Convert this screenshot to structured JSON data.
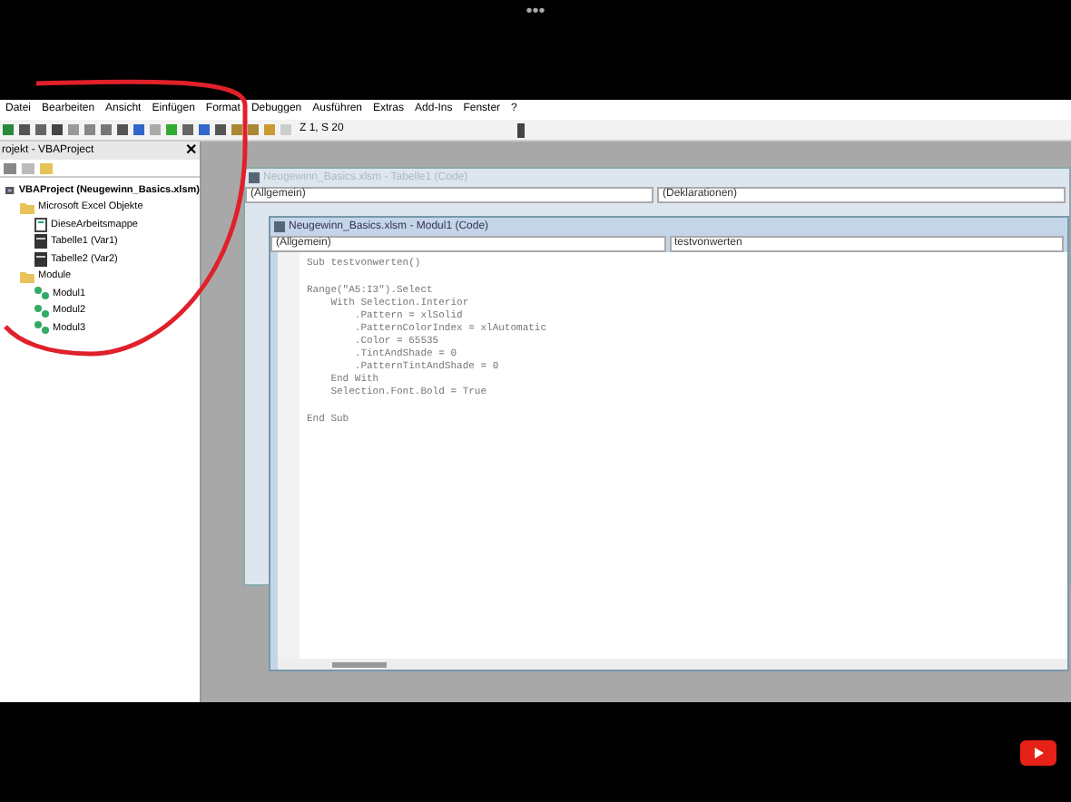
{
  "top_bar": {
    "dots": "•••"
  },
  "menu_bar": [
    "Datei",
    "Bearbeiten",
    "Ansicht",
    "Einfügen",
    "Format",
    "Debuggen",
    "Ausführen",
    "Extras",
    "Add-Ins",
    "Fenster",
    "?"
  ],
  "toolbar": {
    "position": "Z 1, S 20"
  },
  "project_panel": {
    "title": "rojekt - VBAProject",
    "close": "✕",
    "tree": [
      {
        "label": "VBAProject (Neugewinn_Basics.xlsm)",
        "kind": "project",
        "children": [
          {
            "label": "Microsoft Excel Objekte",
            "kind": "folder",
            "children": [
              {
                "label": "DieseArbeitsmappe",
                "kind": "workbook"
              },
              {
                "label": "Tabelle1 (Var1)",
                "kind": "sheet"
              },
              {
                "label": "Tabelle2 (Var2)",
                "kind": "sheet"
              }
            ]
          },
          {
            "label": "Module",
            "kind": "folder",
            "children": [
              {
                "label": "Modul1",
                "kind": "module"
              },
              {
                "label": "Modul2",
                "kind": "module"
              },
              {
                "label": "Modul3",
                "kind": "module"
              }
            ]
          }
        ]
      }
    ]
  },
  "back_window": {
    "title": "Neugewinn_Basics.xlsm - Tabelle1 (Code)",
    "object": "(Allgemein)",
    "procedure": "(Deklarationen)"
  },
  "front_window": {
    "title": "Neugewinn_Basics.xlsm - Modul1 (Code)",
    "object": "(Allgemein)",
    "procedure": "testvonwerten",
    "code_blocks": [
      [
        "Sub testvonwerten()"
      ],
      [
        "Range(\"A5:I3\").Select",
        "    With Selection.Interior",
        "        .Pattern = xlSolid",
        "        .PatternColorIndex = xlAutomatic",
        "        .Color = 65535",
        "        .TintAndShade = 0",
        "        .PatternTintAndShade = 0",
        "    End With",
        "    Selection.Font.Bold = True"
      ],
      [
        "End Sub"
      ]
    ]
  }
}
